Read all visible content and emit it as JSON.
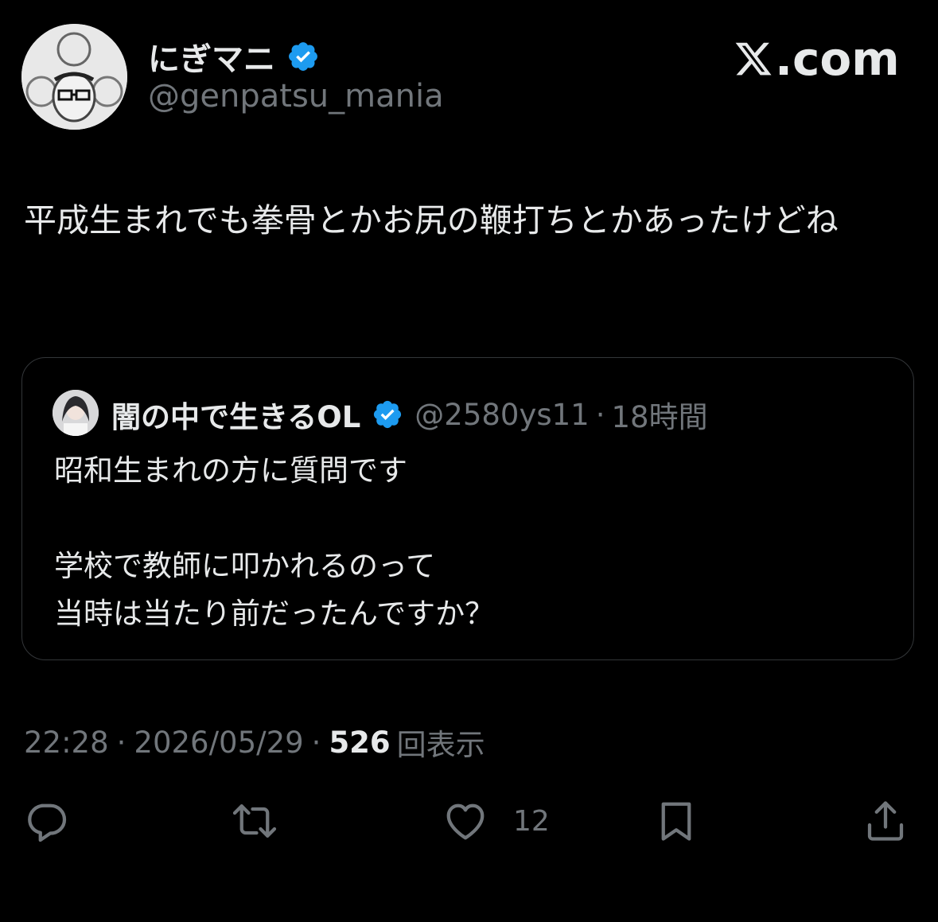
{
  "author": {
    "display_name": "にぎマニ",
    "handle": "@genpatsu_mania",
    "avatar_icon": "avatar-illustration-icon",
    "verified_icon": "verified-badge-icon"
  },
  "site_logo": {
    "text": ".com",
    "icon": "x-logo-icon"
  },
  "tweet": {
    "text": "平成生まれでも拳骨とかお尻の鞭打ちとかあったけどね"
  },
  "quote": {
    "display_name": "闇の中で生きるOL",
    "handle": "@2580ys11",
    "dot": "·",
    "time": "18時間",
    "text": "昭和生まれの方に質問です\n\n学校で教師に叩かれるのって\n当時は当たり前だったんですか？"
  },
  "meta": {
    "time": "22:28",
    "dot": "·",
    "date": "2026/05/29",
    "views_count": "526",
    "views_label": "回表示"
  },
  "actions": {
    "reply_icon": "reply-icon",
    "retweet_icon": "retweet-icon",
    "like_icon": "heart-icon",
    "like_count": "12",
    "bookmark_icon": "bookmark-icon",
    "share_icon": "share-icon"
  },
  "colors": {
    "background": "#000000",
    "text_primary": "#e7e9ea",
    "text_secondary": "#71767b",
    "verified": "#1d9bf0",
    "border": "#333639"
  }
}
